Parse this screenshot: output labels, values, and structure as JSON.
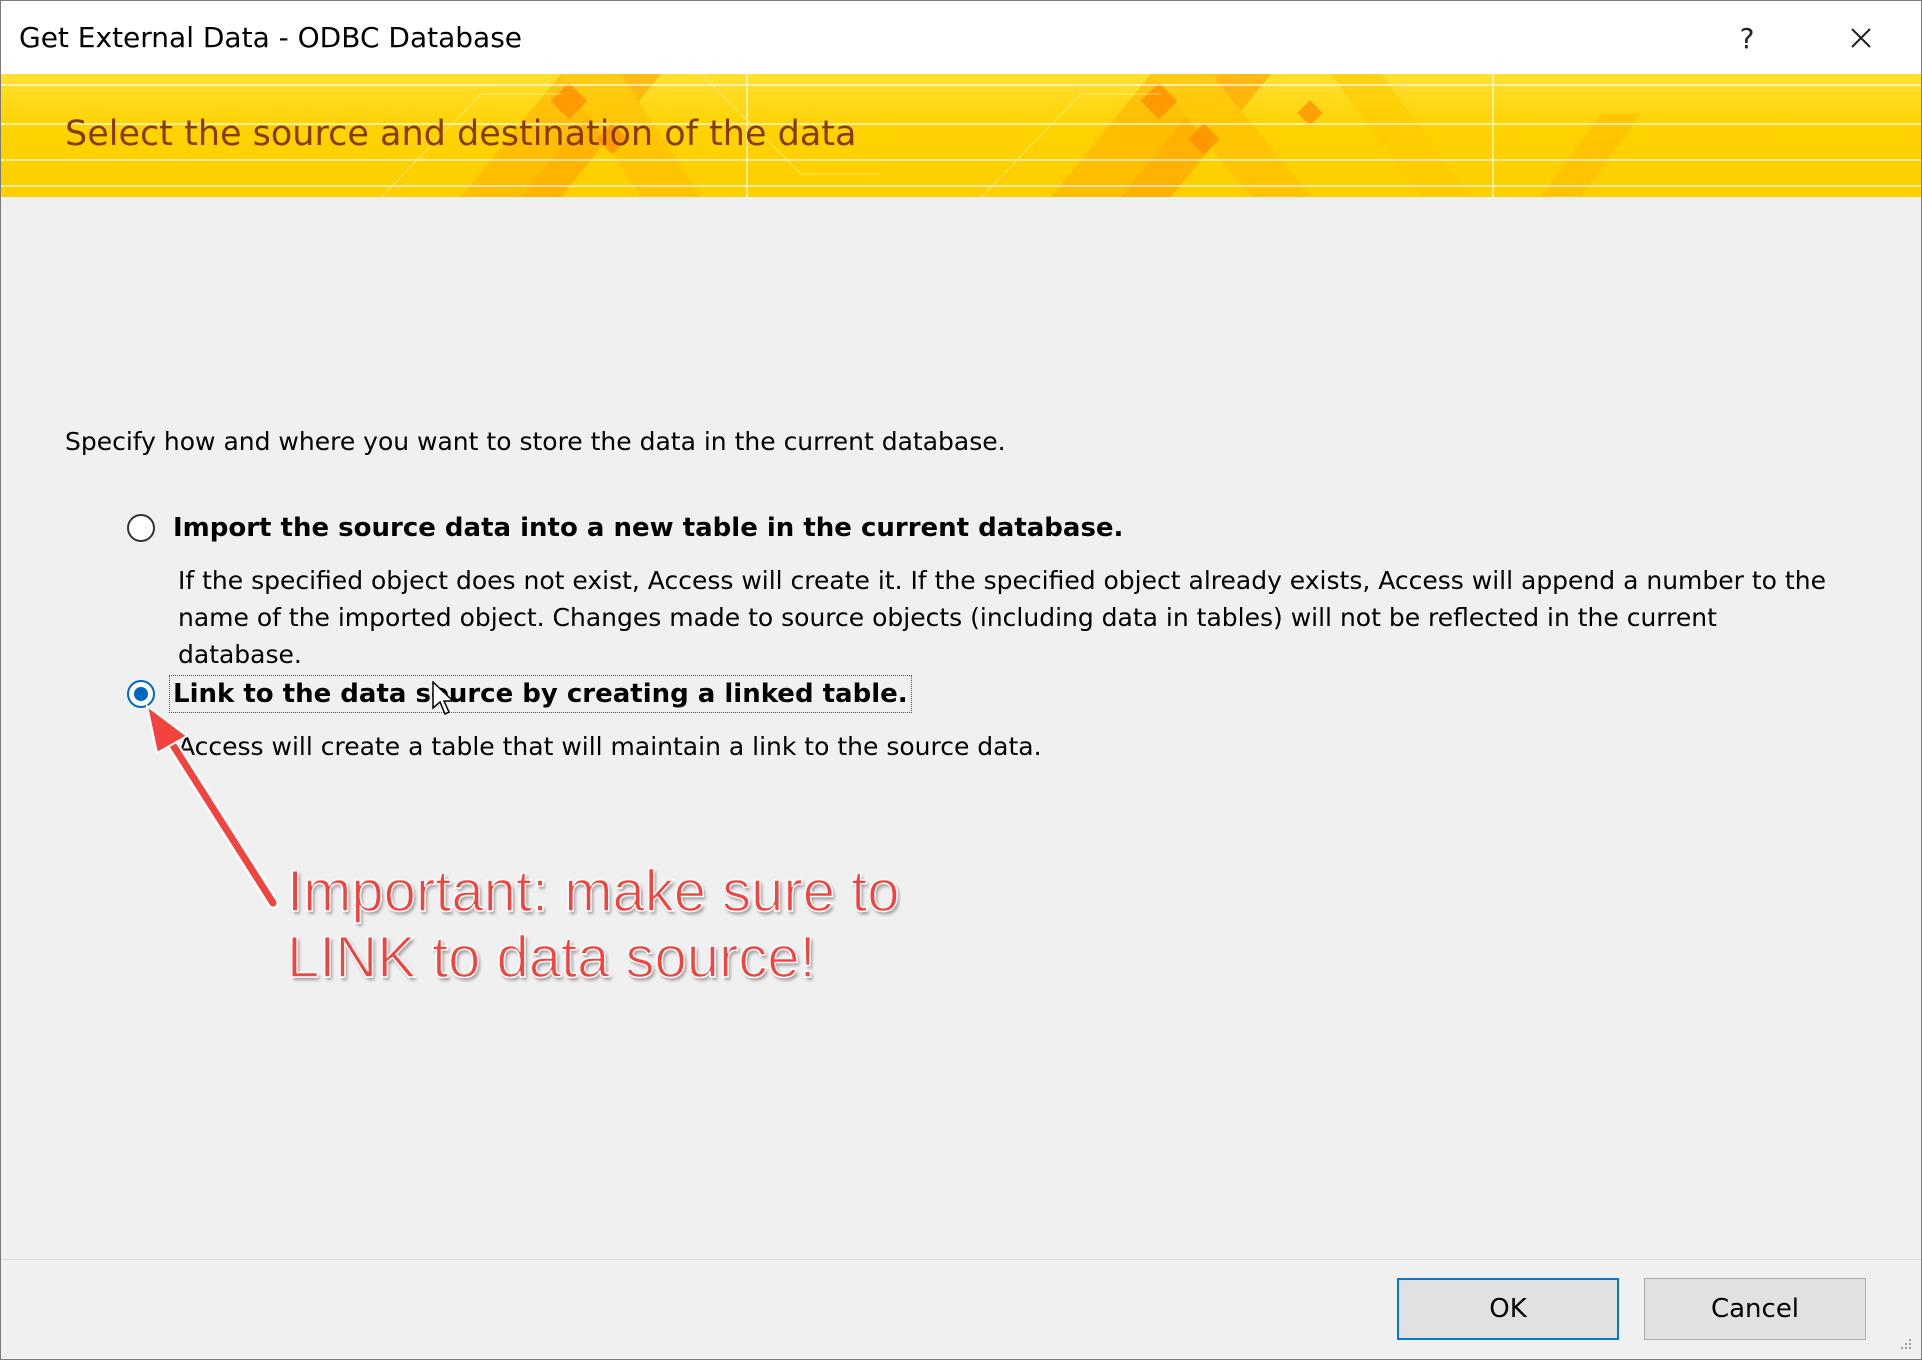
{
  "window": {
    "title": "Get External Data - ODBC Database",
    "help_label": "?"
  },
  "banner": {
    "heading": "Select the source and destination of the data"
  },
  "instruction": "Specify how and where you want to store the data in the current database.",
  "options": [
    {
      "label": "Import the source data into a new table in the current database.",
      "description": "If the specified object does not exist, Access will create it. If the specified object already exists, Access will append a number to the name of the imported object. Changes made to source objects (including data in tables) will not be reflected in the current database.",
      "selected": false
    },
    {
      "label": "Link to the data source by creating a linked table.",
      "description": "Access will create a table that will maintain a link to the source data.",
      "selected": true
    }
  ],
  "annotation": {
    "line1": "Important: make sure to",
    "line2": "LINK to data source!",
    "color": "#f2433e"
  },
  "buttons": {
    "ok": "OK",
    "cancel": "Cancel"
  },
  "colors": {
    "banner": "#ffd200",
    "banner_text": "#8a3a00",
    "accent": "#0067c0"
  }
}
